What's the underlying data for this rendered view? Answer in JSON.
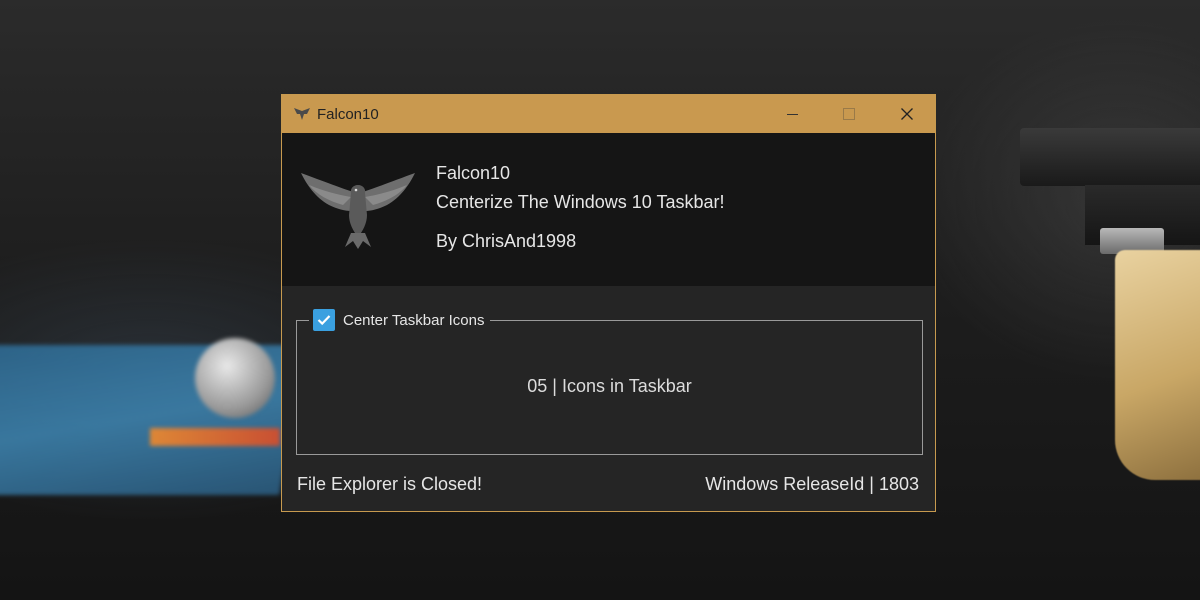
{
  "window": {
    "title": "Falcon10",
    "controls": {
      "minimize_icon": "minimize-icon",
      "maximize_icon": "maximize-icon",
      "close_icon": "close-icon"
    },
    "accent_color": "#c9994f"
  },
  "header": {
    "logo_icon": "falcon-logo-icon",
    "app_name": "Falcon10",
    "tagline": "Centerize The Windows 10 Taskbar!",
    "author": "By ChrisAnd1998"
  },
  "options": {
    "center_icons_label": "Center Taskbar Icons",
    "center_icons_checked": true,
    "checkbox_color": "#3aa0e0",
    "icons_count_text": "05 | Icons in Taskbar"
  },
  "status": {
    "explorer": "File Explorer is Closed!",
    "release": "Windows ReleaseId | 1803"
  }
}
